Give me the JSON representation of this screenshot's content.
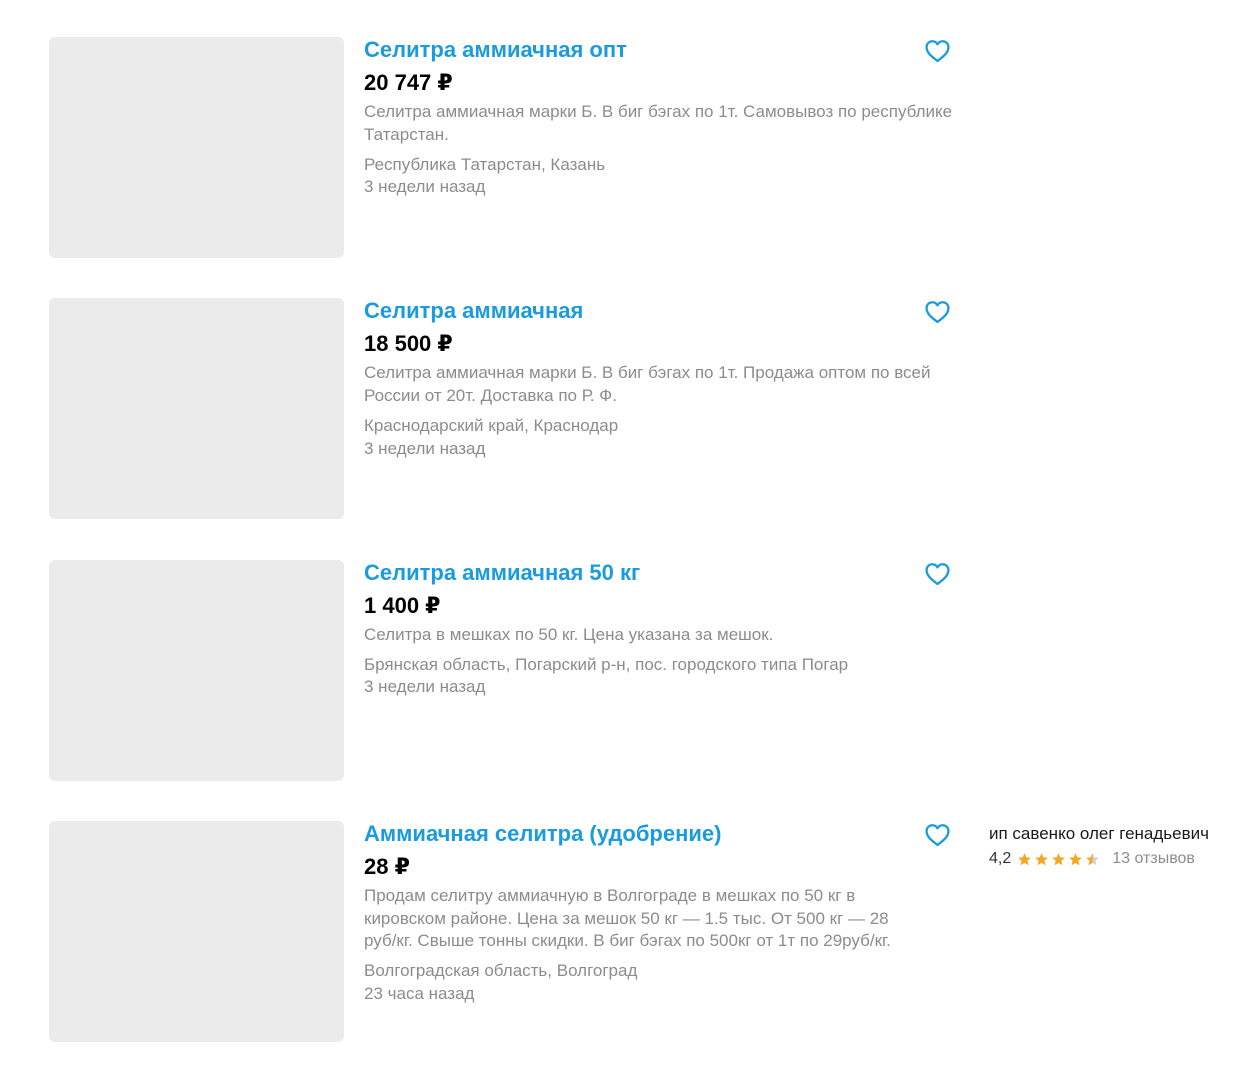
{
  "accent_color": "#1a9be0",
  "star_color": "#f5a623",
  "icons": {
    "favorite": "heart-outline-icon",
    "rating_star": "star-icon"
  },
  "listings": [
    {
      "title": "Селитра аммиачная опт",
      "price": "20 747 ₽",
      "description": "Селитра аммиачная марки Б. В биг бэгах по 1т. Самовывоз по республике Татарстан.",
      "location": "Республика Татарстан, Казань",
      "posted": "3 недели назад"
    },
    {
      "title": "Селитра аммиачная",
      "price": "18 500 ₽",
      "description": "Селитра аммиачная марки Б. В биг бэгах по 1т. Продажа оптом по всей России от 20т. Доставка по Р. Ф.",
      "location": "Краснодарский край, Краснодар",
      "posted": "3 недели назад"
    },
    {
      "title": "Селитра аммиачная 50 кг",
      "price": "1 400 ₽",
      "description": "Селитра в мешках по 50 кг. Цена указана за мешок.",
      "location": "Брянская область, Погарский р-н, пос. городского типа Погар",
      "posted": "3 недели назад"
    },
    {
      "title": "Аммиачная селитра (удобрение)",
      "price": "28 ₽",
      "description": "Продам селитру аммиачную в Волгограде в мешках по 50 кг в кировском районе. Цена за мешок 50 кг — 1.5 тыс. От 500 кг — 28 руб/кг. Свыше тонны скидки. В биг бэгах по 500кг от 1т по 29руб/кг.",
      "location": "Волгоградская область, Волгоград",
      "posted": "23 часа назад",
      "seller": {
        "name": "ип савенко олег генадьевич",
        "rating": "4,2",
        "rating_stars": 4.2,
        "reviews": "13 отзывов"
      }
    }
  ]
}
